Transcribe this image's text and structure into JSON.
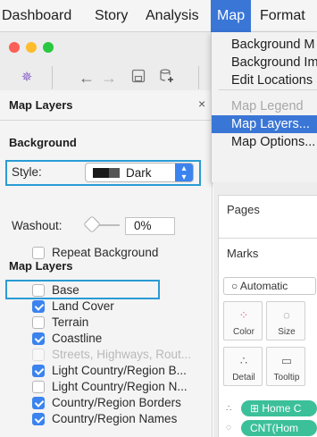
{
  "menubar": {
    "items": [
      "Dashboard",
      "Story",
      "Analysis",
      "Map",
      "Format"
    ]
  },
  "map_menu": {
    "items": [
      {
        "label": "Background M",
        "state": "normal"
      },
      {
        "label": "Background Im",
        "state": "normal"
      },
      {
        "label": "Edit Locations",
        "state": "normal"
      },
      {
        "label": "Map Legend",
        "state": "disabled"
      },
      {
        "label": "Map Layers...",
        "state": "highlighted"
      },
      {
        "label": "Map Options...",
        "state": "normal"
      }
    ]
  },
  "toolbar": {
    "icons": [
      "tableau-logo-icon",
      "back-arrow-icon",
      "forward-arrow-icon",
      "save-icon",
      "add-datasource-icon"
    ]
  },
  "panel": {
    "title": "Map Layers",
    "close_glyph": "×",
    "background_section": "Background",
    "style_label": "Style:",
    "style_value": "Dark",
    "washout_label": "Washout:",
    "washout_value": "0%",
    "washout_level": 0,
    "repeat_background": "Repeat Background",
    "layers_section": "Map Layers",
    "layers": [
      {
        "label": "Base",
        "checked": false,
        "disabled": false
      },
      {
        "label": "Land Cover",
        "checked": true,
        "disabled": false
      },
      {
        "label": "Terrain",
        "checked": false,
        "disabled": false
      },
      {
        "label": "Coastline",
        "checked": true,
        "disabled": false
      },
      {
        "label": "Streets, Highways, Rout...",
        "checked": false,
        "disabled": true
      },
      {
        "label": "Light Country/Region B...",
        "checked": true,
        "disabled": false
      },
      {
        "label": "Light Country/Region N...",
        "checked": false,
        "disabled": false
      },
      {
        "label": "Country/Region Borders",
        "checked": true,
        "disabled": false
      },
      {
        "label": "Country/Region Names",
        "checked": true,
        "disabled": false
      }
    ]
  },
  "right": {
    "pages_title": "Pages",
    "marks_title": "Marks",
    "mark_type": "Automatic",
    "mark_buttons": [
      {
        "label": "Color",
        "icon": "color-dots-icon"
      },
      {
        "label": "Size",
        "icon": "size-icon"
      },
      {
        "label": "Detail",
        "icon": "detail-dots-icon"
      },
      {
        "label": "Tooltip",
        "icon": "tooltip-icon"
      }
    ],
    "pills": [
      "⊞ Home C",
      "CNT(Hom"
    ]
  },
  "colors": {
    "accent": "#3a76d6",
    "highlight_box": "#2a9bd5",
    "checkbox": "#3b83ee",
    "pill": "#3cc09a"
  }
}
